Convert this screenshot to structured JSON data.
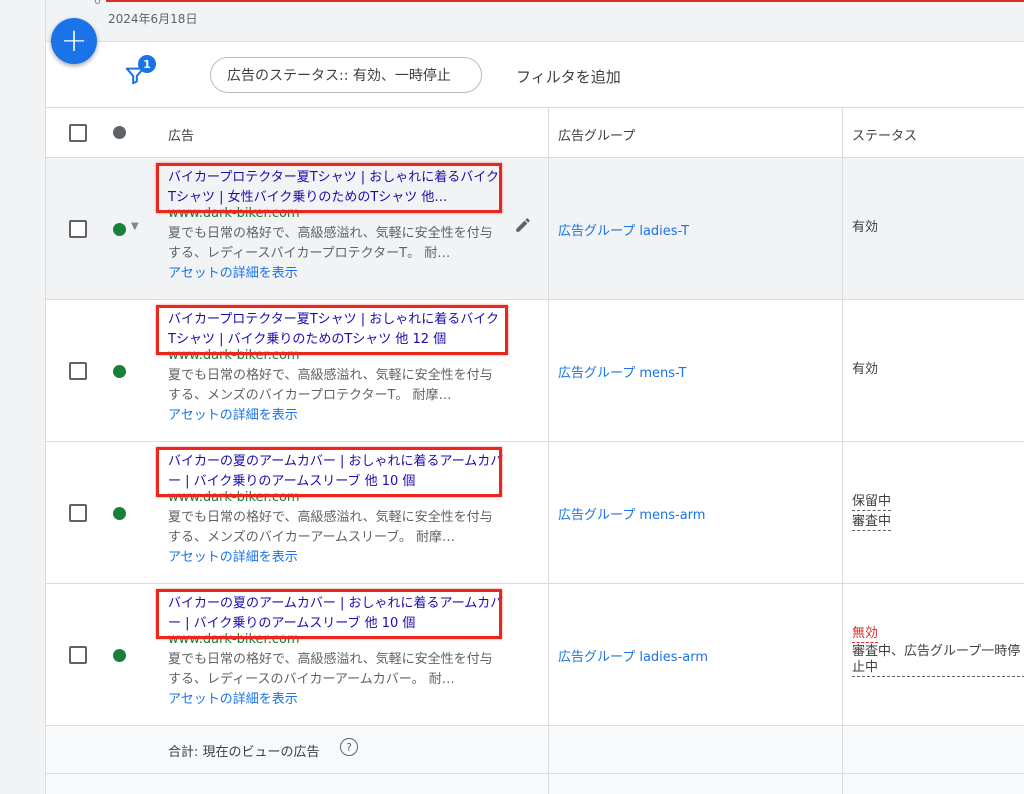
{
  "chart_strip": {
    "zero_label": "0",
    "date_label": "2024年6月18日"
  },
  "colors": {
    "accent": "#1a73e8",
    "enabled": "#188038",
    "danger": "#d93025",
    "highlight_box": "#e8281e"
  },
  "filter": {
    "badge_count": "1",
    "chip_text": "広告のステータス:: 有効、一時停止",
    "add_filter_label": "フィルタを追加"
  },
  "table": {
    "headers": {
      "ad": "広告",
      "ad_group": "広告グループ",
      "status": "ステータス"
    },
    "rows": [
      {
        "headline": "バイカープロテクター夏Tシャツ | おしゃれに着るバイクTシャツ | 女性バイク乗りのためのTシャツ  他…",
        "url": "www.dark-biker.com",
        "description": "夏でも日常の格好で、高級感溢れ、気軽に安全性を付与する、レディースバイカープロテクターT。 耐…",
        "assets_link": "アセットの詳細を表示",
        "ad_group": "広告グループ ladies-T",
        "status_line1": "有効",
        "status_line2": ""
      },
      {
        "headline": "バイカープロテクター夏Tシャツ | おしゃれに着るバイクTシャツ | バイク乗りのためのTシャツ  他 12 個",
        "url": "www.dark-biker.com",
        "description": "夏でも日常の格好で、高級感溢れ、気軽に安全性を付与する、メンズのバイカープロテクターT。 耐摩…",
        "assets_link": "アセットの詳細を表示",
        "ad_group": "広告グループ mens-T",
        "status_line1": "有効",
        "status_line2": ""
      },
      {
        "headline": "バイカーの夏のアームカバー | おしゃれに着るアームカバー | バイク乗りのアームスリーブ  他 10 個",
        "url": "www.dark-biker.com",
        "description": "夏でも日常の格好で、高級感溢れ、気軽に安全性を付与する、メンズのバイカーアームスリーブ。 耐摩…",
        "assets_link": "アセットの詳細を表示",
        "ad_group": "広告グループ mens-arm",
        "status_line1": "保留中",
        "status_line2": "審査中"
      },
      {
        "headline": "バイカーの夏のアームカバー | おしゃれに着るアームカバー | バイク乗りのアームスリーブ  他 10 個",
        "url": "www.dark-biker.com",
        "description": "夏でも日常の格好で、高級感溢れ、気軽に安全性を付与する、レディースのバイカーアームカバー。 耐…",
        "assets_link": "アセットの詳細を表示",
        "ad_group": "広告グループ ladies-arm",
        "status_line1": "無効",
        "status_line2": "審査中、広告グループ一時停止中"
      }
    ],
    "total_label": "合計: 現在のビューの広告"
  }
}
